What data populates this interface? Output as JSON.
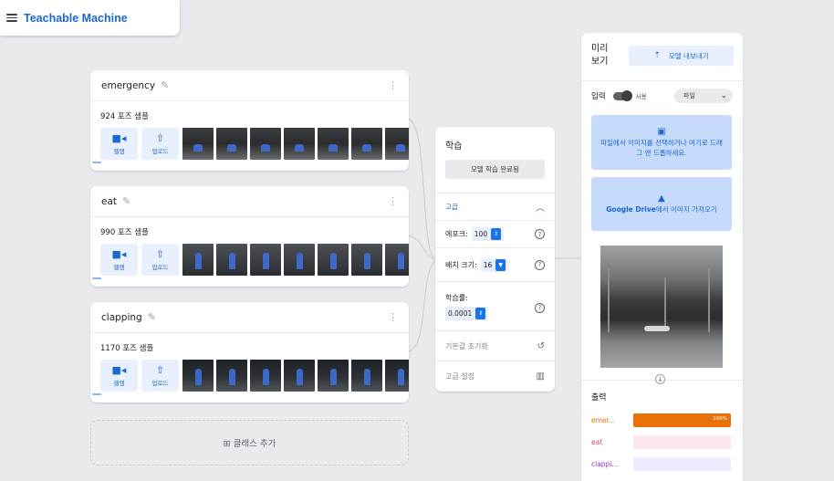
{
  "app": {
    "title": "Teachable Machine"
  },
  "classes": [
    {
      "name": "emergency",
      "samples_label": "924 포즈 샘플",
      "webcam_label": "웹캠",
      "upload_label": "업로드"
    },
    {
      "name": "eat",
      "samples_label": "990 포즈 샘플",
      "webcam_label": "웹캠",
      "upload_label": "업로드"
    },
    {
      "name": "clapping",
      "samples_label": "1170 포즈 샘플",
      "webcam_label": "웹캠",
      "upload_label": "업로드"
    }
  ],
  "add_class": {
    "label": "⊞ 클래스 추가"
  },
  "training": {
    "title": "학습",
    "train_button": "모델 학습 완료됨",
    "advanced_label": "고급",
    "epochs": {
      "label": "에포크:",
      "value": "100"
    },
    "batch_size": {
      "label": "배치 크기:",
      "value": "16"
    },
    "learning_rate": {
      "label": "학습률:",
      "value": "0.0001"
    },
    "reset_label": "기본값 초기화",
    "under_hood_label": "고급 설정"
  },
  "preview": {
    "title": "미리 보기",
    "export_button": "모델 내보내기",
    "input_label": "입력",
    "toggle_label": "사용",
    "source_select": "파일",
    "drop_text": "파일에서 이미지를 선택하거나 여기로 드래그 앤 드롭하세요.",
    "drive_brand": "Google Drive",
    "drive_text": "에서 이미지 가져오기",
    "output_title": "출력",
    "outputs": [
      {
        "label": "emer...",
        "value": 1.0,
        "pct_text": "100%",
        "color": "#e8710a",
        "track": "#fce8d9",
        "label_color": "#e8710a"
      },
      {
        "label": "eat",
        "value": 0.0,
        "pct_text": "",
        "color": "#e52592",
        "track": "#fde7ef",
        "label_color": "#d93f7e"
      },
      {
        "label": "clappi...",
        "value": 0.0,
        "pct_text": "",
        "color": "#9334e6",
        "track": "#efeafd",
        "label_color": "#9334e6"
      }
    ]
  },
  "icons": {
    "menu": "menu-icon",
    "pencil": "pencil-icon",
    "kebab": "more-vert-icon",
    "webcam": "videocam-icon",
    "upload": "upload-icon",
    "chevron": "chevron-up-icon",
    "help": "help-icon",
    "reset": "history-icon",
    "chart": "chart-icon",
    "export": "upload-icon",
    "folder": "folder-icon",
    "drive": "drive-icon",
    "down": "arrow-down-icon"
  }
}
